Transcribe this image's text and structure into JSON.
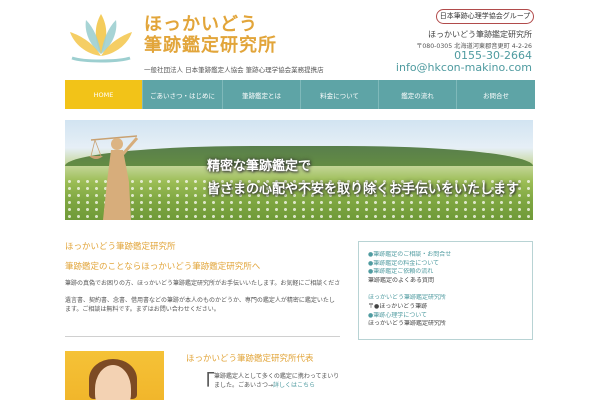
{
  "header": {
    "logo_title_1": "ほっかいどう",
    "logo_title_2": "筆跡鑑定研究所",
    "logo_subtitle": "一般社団法人 日本筆跡鑑定人協会 筆跡心理学協会業務提携店",
    "group_badge": "日本筆跡心理学協会グループ",
    "org_name": "ほっかいどう筆跡鑑定研究所",
    "address": "〒080-0305 北海道河東郡音更町 4-2-26",
    "tel": "0155-30-2664",
    "email": "info@hkcon-makino.com"
  },
  "nav": {
    "items": [
      {
        "label": "HOME",
        "active": true
      },
      {
        "label": "ごあいさつ・はじめに",
        "active": false
      },
      {
        "label": "筆跡鑑定とは",
        "active": false
      },
      {
        "label": "料金について",
        "active": false
      },
      {
        "label": "鑑定の流れ",
        "active": false
      },
      {
        "label": "お問合せ",
        "active": false
      }
    ]
  },
  "hero": {
    "line1": "精密な筆跡鑑定で",
    "line2": "皆さまの心配や不安を取り除くお手伝いをいたします"
  },
  "main": {
    "heading": "ほっかいどう筆跡鑑定研究所",
    "subheading": "筆跡鑑定のことならほっかいどう筆跡鑑定研究所へ",
    "paragraph1": "筆跡の真偽でお困りの方、ほっかいどう筆跡鑑定研究所がお手伝いいたします。お気軽にご相談ください。",
    "paragraph2": "遺言書、契約書、念書、借用書などの筆跡が本人のものかどうか、専門の鑑定人が精密に鑑定いたします。ご相談は無料です。まずはお問い合わせください。",
    "sub_heading": "ほっかいどう筆跡鑑定研究所代表",
    "bracket": "「",
    "bottom_text": "筆跡鑑定人として多くの鑑定に携わってまいりました。ごあいさつ→",
    "bottom_link": "詳しくはこちら"
  },
  "sidebar": {
    "group1": [
      "●筆跡鑑定のご相談・お問合せ",
      "●筆跡鑑定の料金について",
      "●筆跡鑑定ご依頼の流れ",
      "筆跡鑑定のよくある質問"
    ],
    "group2": [
      "ほっかいどう筆跡鑑定研究所",
      "〒●ほっかいどう筆跡",
      "●筆跡心理学について",
      "ほっかいどう筆跡鑑定研究所"
    ]
  },
  "colors": {
    "accent_orange": "#e2a53a",
    "nav_teal": "#5ea4a6",
    "nav_active": "#f2c318",
    "link_teal": "#4f9ba0",
    "badge_border": "#b14b4b"
  }
}
